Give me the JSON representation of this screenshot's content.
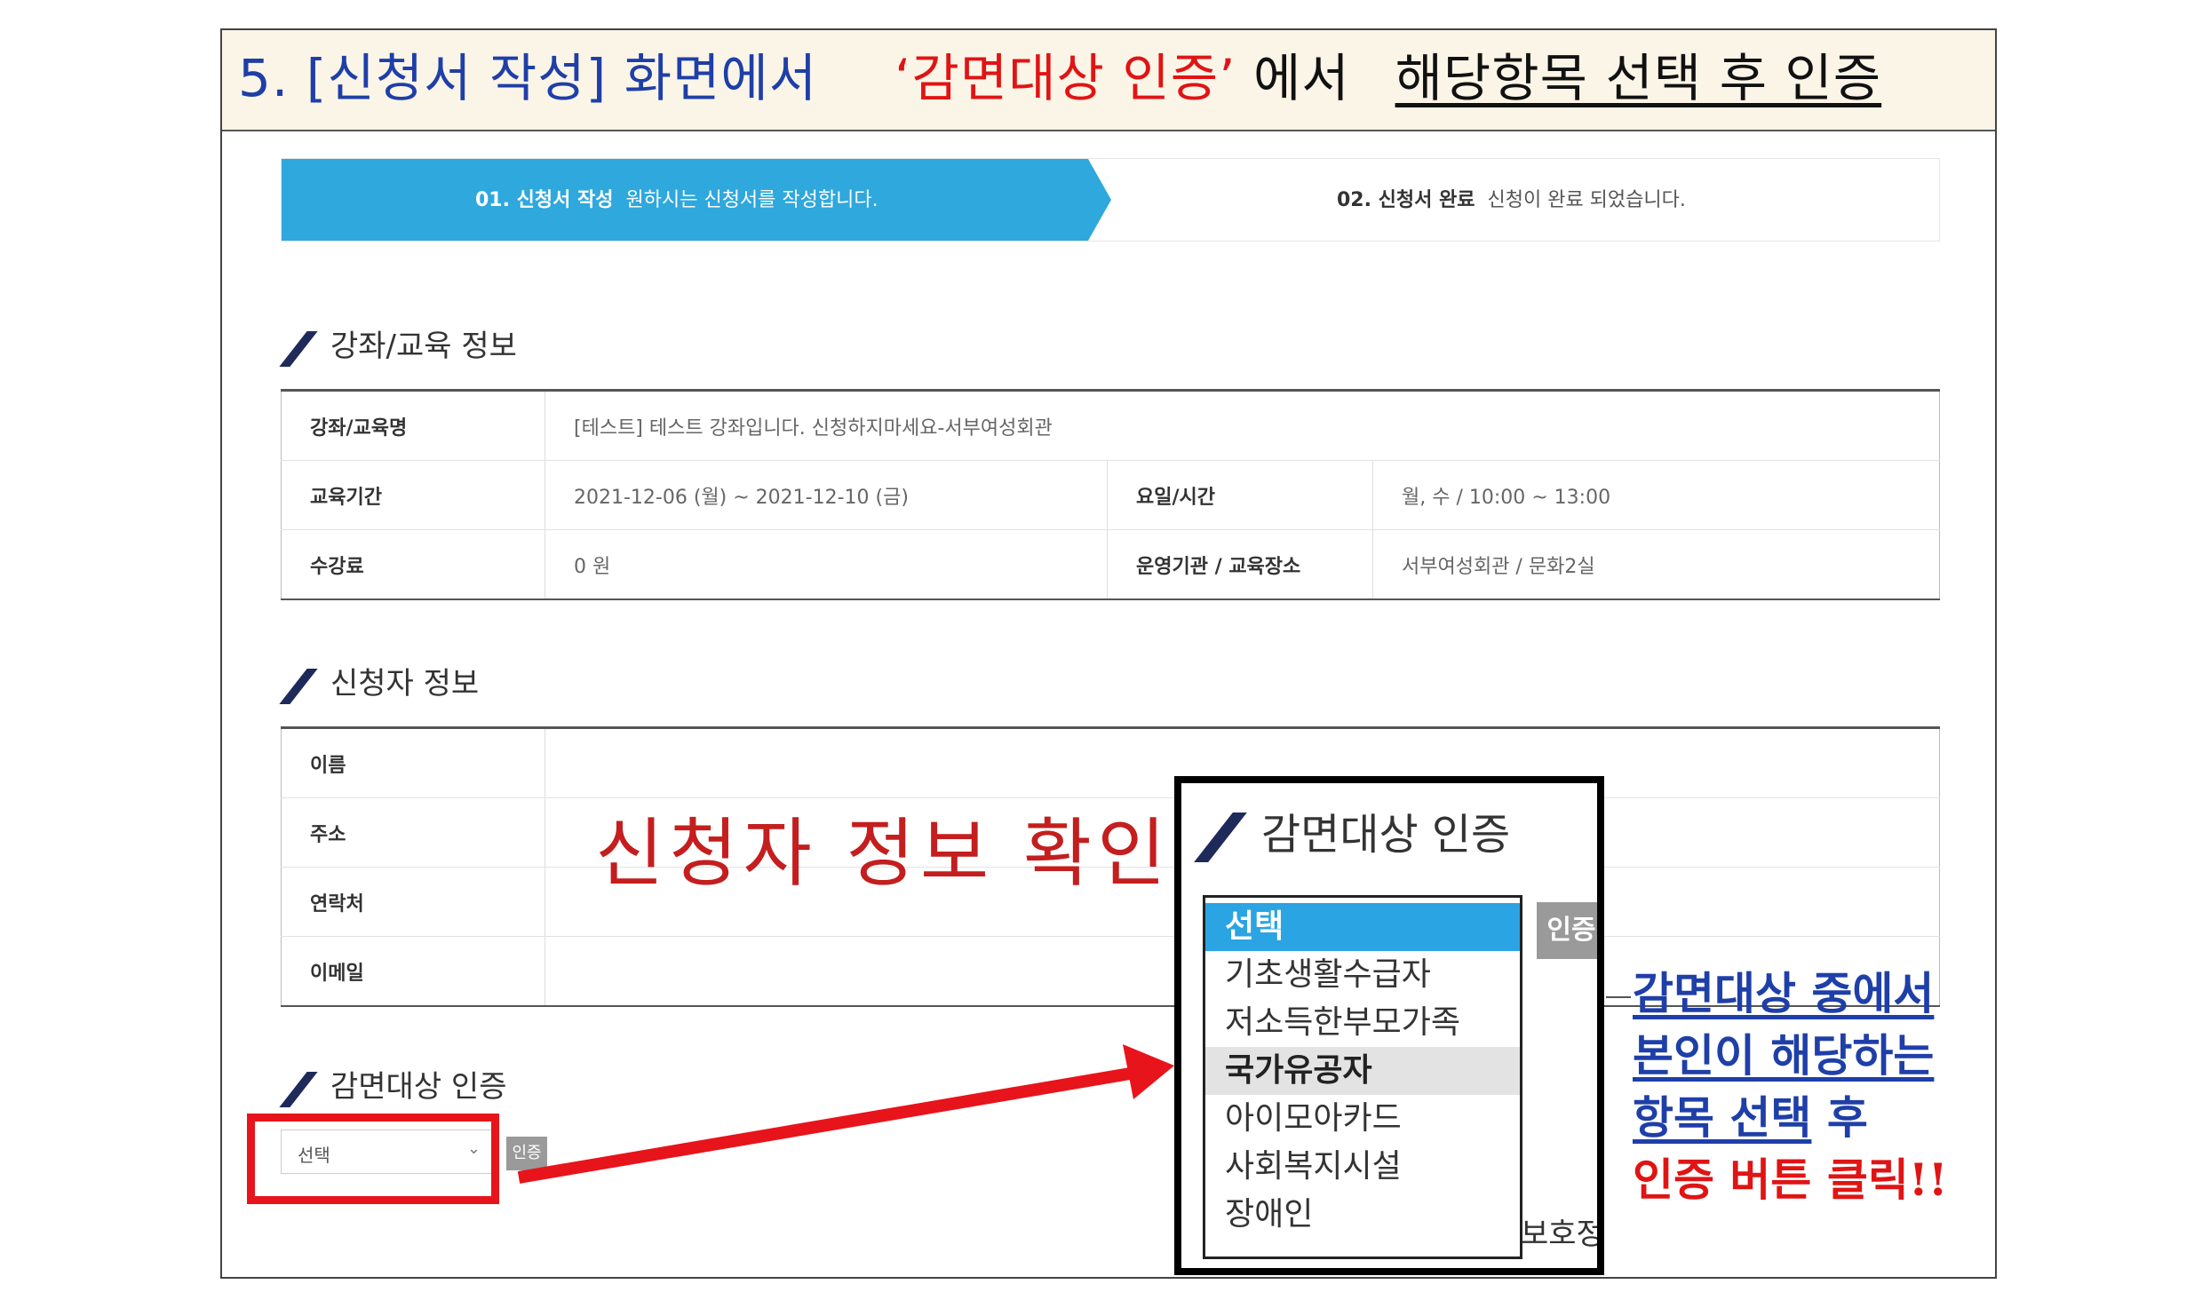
{
  "banner": {
    "part1": "5. [신청서 작성] 화면에서",
    "part2": "‘감면대상 인증’",
    "part3": "에서",
    "part4": "해당항목 선택 후 인증"
  },
  "steps": [
    {
      "num": "01. 신청서 작성",
      "desc": "원하시는 신청서를 작성합니다."
    },
    {
      "num": "02. 신청서 완료",
      "desc": "신청이 완료 되었습니다."
    }
  ],
  "sections": {
    "course": "강좌/교육 정보",
    "applicant": "신청자 정보",
    "discount": "감면대상 인증"
  },
  "course_table": {
    "name_label": "강좌/교육명",
    "name_value": "[테스트] 테스트 강좌입니다. 신청하지마세요-서부여성회관",
    "period_label": "교육기간",
    "period_value": "2021-12-06 (월) ~ 2021-12-10 (금)",
    "daytime_label": "요일/시간",
    "daytime_value": "월, 수 / 10:00 ~ 13:00",
    "fee_label": "수강료",
    "fee_value": "0 원",
    "org_label": "운영기관 / 교육장소",
    "org_value": "서부여성회관 / 문화2실"
  },
  "applicant_table": {
    "name_label": "이름",
    "address_label": "주소",
    "phone_label": "연락처",
    "email_label": "이메일"
  },
  "overlay_text": "신청자 정보 확인",
  "mini": {
    "select_value": "선택",
    "button": "인증"
  },
  "zoom": {
    "title": "감면대상 인증",
    "button": "인증",
    "options": [
      "선택",
      "기초생활수급자",
      "저소득한부모가족",
      "국가유공자",
      "아이모아카드",
      "사회복지시설",
      "장애인"
    ],
    "selected": "선택",
    "highlighted": "국가유공자",
    "peek_text": "보호정책"
  },
  "note": {
    "line1": "감면대상 중에서",
    "line2": "본인이 해당하는",
    "line3a": "항목 선택",
    "line3b": " 후",
    "line4": "인증 버튼 클릭!!"
  },
  "colors": {
    "banner_bg": "#fbf5e7",
    "blue": "#1f3fa8",
    "red": "#e01414",
    "step_active": "#2ea8dd",
    "select_highlight": "#2aa4e2"
  }
}
